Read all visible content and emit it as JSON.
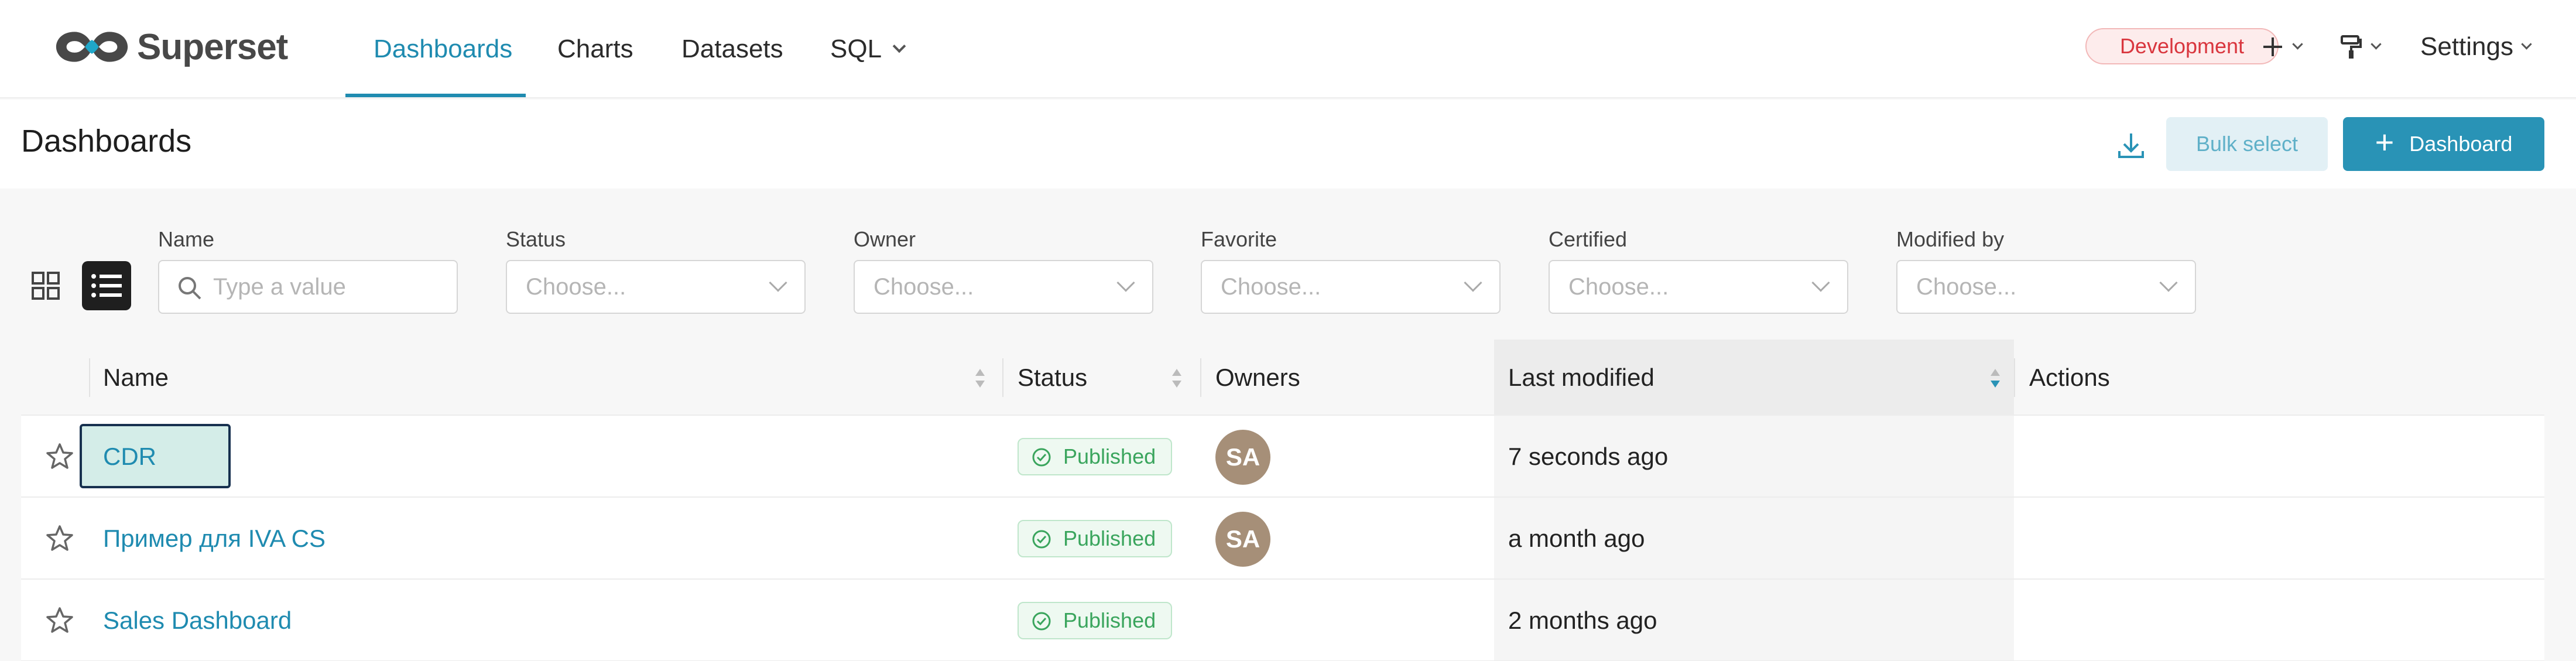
{
  "app": {
    "name": "Superset",
    "env_badge": "Development"
  },
  "nav": {
    "items": [
      {
        "label": "Dashboards",
        "active": true
      },
      {
        "label": "Charts",
        "active": false
      },
      {
        "label": "Datasets",
        "active": false
      },
      {
        "label": "SQL",
        "active": false,
        "has_dropdown": true
      }
    ],
    "settings_label": "Settings"
  },
  "header": {
    "title": "Dashboards",
    "bulk_select_label": "Bulk select",
    "add_label": "Dashboard",
    "download_icon": "download-icon"
  },
  "filters": [
    {
      "label": "Name",
      "placeholder": "Type a value",
      "type": "search"
    },
    {
      "label": "Status",
      "placeholder": "Choose...",
      "type": "select"
    },
    {
      "label": "Owner",
      "placeholder": "Choose...",
      "type": "select"
    },
    {
      "label": "Favorite",
      "placeholder": "Choose...",
      "type": "select"
    },
    {
      "label": "Certified",
      "placeholder": "Choose...",
      "type": "select"
    },
    {
      "label": "Modified by",
      "placeholder": "Choose...",
      "type": "select"
    }
  ],
  "table": {
    "columns": [
      "Name",
      "Status",
      "Owners",
      "Last modified",
      "Actions"
    ],
    "rows": [
      {
        "name": "CDR",
        "status": "Published",
        "owner": "SA",
        "modified": "7 seconds ago"
      },
      {
        "name": "Пример для IVA CS",
        "status": "Published",
        "owner": "SA",
        "modified": "a month ago"
      },
      {
        "name": "Sales Dashboard",
        "status": "Published",
        "owner": "",
        "modified": "2 months ago"
      }
    ]
  },
  "colors": {
    "primary": "#2993b6",
    "link": "#1f8bb0",
    "published": "#3aa55d",
    "env_badge": "#d9363e",
    "avatar": "#a68f78"
  }
}
